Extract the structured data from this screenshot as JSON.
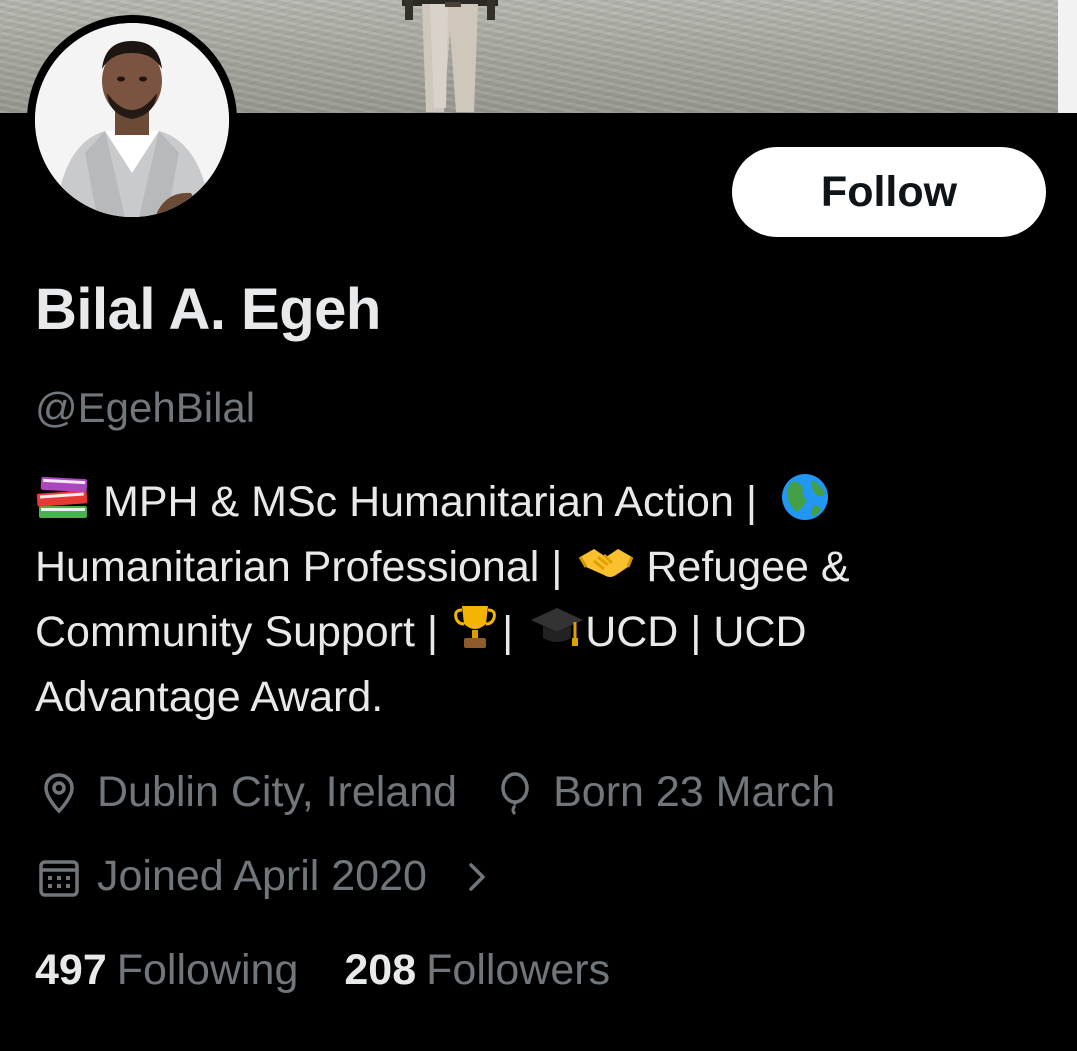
{
  "profile": {
    "display_name": "Bilal A. Egeh",
    "handle": "@EgehBilal",
    "follow_label": "Follow"
  },
  "bio": {
    "line1": "MPH & MSc Humanitarian Action |",
    "line2a": "Humanitarian Professional |",
    "line2b": "Refugee &",
    "line3a": "Community Support |",
    "line3b": "|",
    "line3c": "UCD  | UCD",
    "line4": "Advantage Award."
  },
  "meta": {
    "location": "Dublin City, Ireland",
    "birthday": "Born 23 March",
    "joined": "Joined April 2020",
    "icons": [
      "location-pin-icon",
      "balloon-icon",
      "calendar-icon",
      "chevron-right-icon"
    ]
  },
  "stats": {
    "following_count": "497",
    "following_label": "Following",
    "followers_count": "208",
    "followers_label": "Followers"
  },
  "emoji_icons": [
    "books-emoji-icon",
    "globe-emoji-icon",
    "handshake-emoji-icon",
    "trophy-emoji-icon",
    "graduation-cap-emoji-icon"
  ],
  "colors": {
    "background": "#000000",
    "text_primary": "#e7e9ea",
    "text_secondary": "#71767b",
    "follow_bg": "#ffffff",
    "follow_text": "#0f1419"
  }
}
